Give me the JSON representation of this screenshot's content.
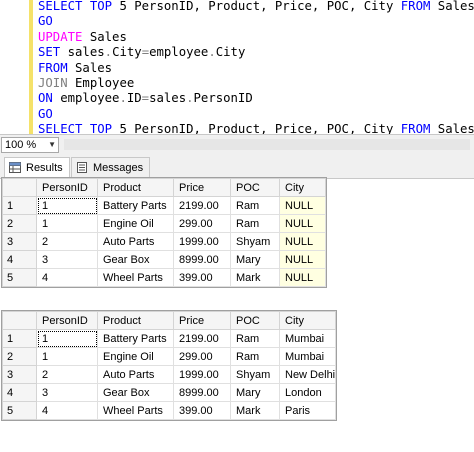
{
  "editor": {
    "lines": [
      [
        {
          "t": "SELECT TOP ",
          "c": "kw"
        },
        {
          "t": "5 PersonID, Product, Price, POC, City ",
          "c": "tx"
        },
        {
          "t": "FROM ",
          "c": "kw"
        },
        {
          "t": "Sales",
          "c": "tx"
        }
      ],
      [
        {
          "t": "GO",
          "c": "kw"
        }
      ],
      [
        {
          "t": "UPDATE ",
          "c": "fn"
        },
        {
          "t": "Sales",
          "c": "tx"
        }
      ],
      [
        {
          "t": "SET ",
          "c": "kw"
        },
        {
          "t": "sales",
          "c": "tx"
        },
        {
          "t": ".",
          "c": "gy"
        },
        {
          "t": "City",
          "c": "tx"
        },
        {
          "t": "=",
          "c": "gy"
        },
        {
          "t": "employee",
          "c": "tx"
        },
        {
          "t": ".",
          "c": "gy"
        },
        {
          "t": "City",
          "c": "tx"
        }
      ],
      [
        {
          "t": "FROM ",
          "c": "kw"
        },
        {
          "t": "Sales",
          "c": "tx"
        }
      ],
      [
        {
          "t": "JOIN ",
          "c": "gy"
        },
        {
          "t": "Employee",
          "c": "tx"
        }
      ],
      [
        {
          "t": "ON ",
          "c": "kw"
        },
        {
          "t": "employee",
          "c": "tx"
        },
        {
          "t": ".",
          "c": "gy"
        },
        {
          "t": "ID",
          "c": "tx"
        },
        {
          "t": "=",
          "c": "gy"
        },
        {
          "t": "sales",
          "c": "tx"
        },
        {
          "t": ".",
          "c": "gy"
        },
        {
          "t": "PersonID",
          "c": "tx"
        }
      ],
      [
        {
          "t": "GO",
          "c": "kw"
        }
      ],
      [
        {
          "t": "SELECT TOP ",
          "c": "kw"
        },
        {
          "t": "5 PersonID, Product, Price, POC, City ",
          "c": "tx"
        },
        {
          "t": "FROM ",
          "c": "kw"
        },
        {
          "t": "Sales",
          "c": "tx"
        }
      ]
    ]
  },
  "zoom": {
    "value": "100 %"
  },
  "tabs": {
    "results": "Results",
    "messages": "Messages"
  },
  "colors": {
    "keyword": "#0000ff",
    "update_keyword": "#ff00ff",
    "operator": "#808080",
    "null_cell": "#ffffe1",
    "change_bar": "#f5e26a"
  },
  "grid1": {
    "columns": [
      "PersonID",
      "Product",
      "Price",
      "POC",
      "City"
    ],
    "rows": [
      [
        "1",
        "1",
        "Battery Parts",
        "2199.00",
        "Ram",
        "NULL"
      ],
      [
        "2",
        "1",
        "Engine Oil",
        "299.00",
        "Ram",
        "NULL"
      ],
      [
        "3",
        "2",
        "Auto Parts",
        "1999.00",
        "Shyam",
        "NULL"
      ],
      [
        "4",
        "3",
        "Gear Box",
        "8999.00",
        "Mary",
        "NULL"
      ],
      [
        "5",
        "4",
        "Wheel Parts",
        "399.00",
        "Mark",
        "NULL"
      ]
    ]
  },
  "grid2": {
    "columns": [
      "PersonID",
      "Product",
      "Price",
      "POC",
      "City"
    ],
    "rows": [
      [
        "1",
        "1",
        "Battery Parts",
        "2199.00",
        "Ram",
        "Mumbai"
      ],
      [
        "2",
        "1",
        "Engine Oil",
        "299.00",
        "Ram",
        "Mumbai"
      ],
      [
        "3",
        "2",
        "Auto Parts",
        "1999.00",
        "Shyam",
        "New Delhi"
      ],
      [
        "4",
        "3",
        "Gear Box",
        "8999.00",
        "Mary",
        "London"
      ],
      [
        "5",
        "4",
        "Wheel Parts",
        "399.00",
        "Mark",
        "Paris"
      ]
    ]
  }
}
